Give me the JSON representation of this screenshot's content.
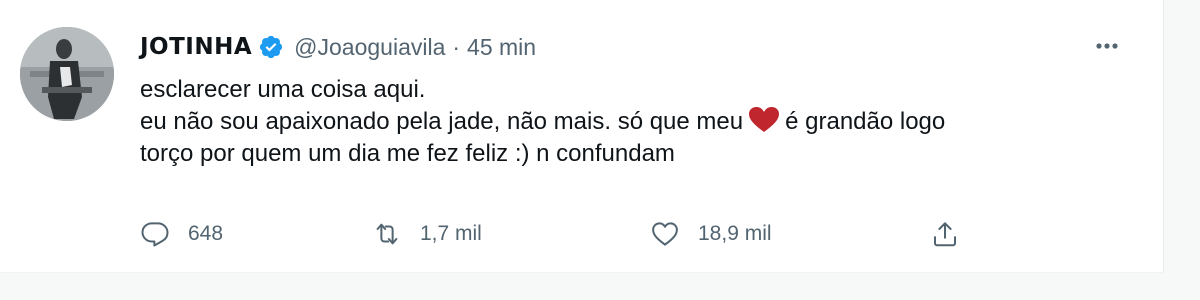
{
  "tweet": {
    "author": {
      "display_name": "JOTINHA",
      "handle": "@Joaoguiavila",
      "verified": true
    },
    "separator": "·",
    "timestamp": "45 min",
    "text_lines": [
      "esclarecer uma coisa aqui.",
      "torço por quem um dia me fez feliz :) n confundam"
    ],
    "line2_before_emoji": "eu não sou apaixonado pela jade, não mais. só que meu",
    "line2_emoji": "red-heart",
    "line2_after_emoji": "é grandão logo",
    "metrics": {
      "replies": "648",
      "retweets": "1,7 mil",
      "likes": "18,9 mil"
    }
  },
  "colors": {
    "text": "#0f1419",
    "secondary": "#536471",
    "verified_blue": "#1d9bf0",
    "heart_red": "#c0262d"
  },
  "icons": {
    "more": "more-icon",
    "reply": "reply-icon",
    "retweet": "retweet-icon",
    "like": "like-icon",
    "share": "share-icon"
  }
}
